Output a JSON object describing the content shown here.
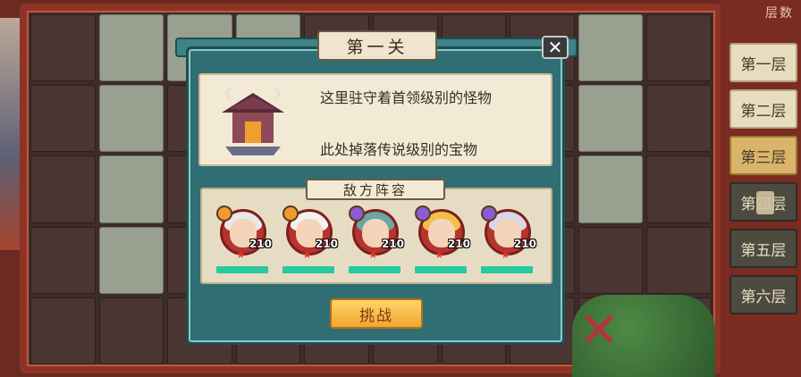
{
  "floors_panel": {
    "title": "层数",
    "items": [
      {
        "label": "第一层",
        "state": "normal"
      },
      {
        "label": "第二层",
        "state": "normal"
      },
      {
        "label": "第三层",
        "state": "active"
      },
      {
        "label": "第四层",
        "state": "locked"
      },
      {
        "label": "第五层",
        "state": "dark"
      },
      {
        "label": "第六层",
        "state": "dark"
      }
    ]
  },
  "dialog": {
    "title": "第一关",
    "close_icon": "close-icon",
    "info_lines": [
      "这里驻守着首领级别的怪物",
      "此处掉落传说级别的宝物"
    ],
    "enemy_section_label": "敌方阵容",
    "enemies": [
      {
        "level": "210",
        "badge_color": "#f09a2e",
        "hair_color": "#e8e8e8",
        "stars": 1,
        "hp": 1.0
      },
      {
        "level": "210",
        "badge_color": "#f09a2e",
        "hair_color": "#f2f2f2",
        "stars": 1,
        "hp": 1.0
      },
      {
        "level": "210",
        "badge_color": "#8b5ad6",
        "hair_color": "#6aa6a8",
        "stars": 1,
        "hp": 1.0
      },
      {
        "level": "210",
        "badge_color": "#8b5ad6",
        "hair_color": "#f2c04a",
        "stars": 1,
        "hp": 1.0
      },
      {
        "level": "210",
        "badge_color": "#8b5ad6",
        "hair_color": "#d9d6e8",
        "stars": 1,
        "hp": 1.0
      }
    ],
    "challenge_label": "挑战"
  },
  "colors": {
    "dialog_teal": "#2f6f73",
    "hp_green": "#28c9a0",
    "board_red": "#8e3326"
  }
}
